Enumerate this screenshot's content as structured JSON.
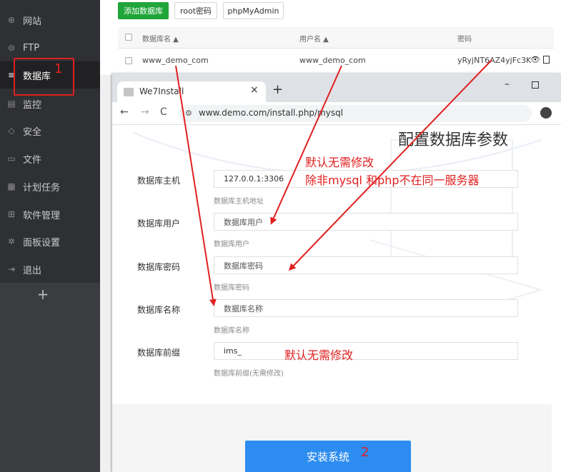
{
  "sidebar": {
    "items": [
      {
        "label": "网站",
        "icon": "globe-icon"
      },
      {
        "label": "FTP",
        "icon": "ftp-icon"
      },
      {
        "label": "数据库",
        "icon": "database-icon"
      },
      {
        "label": "监控",
        "icon": "monitor-icon"
      },
      {
        "label": "安全",
        "icon": "shield-icon"
      },
      {
        "label": "文件",
        "icon": "folder-icon"
      },
      {
        "label": "计划任务",
        "icon": "calendar-icon"
      },
      {
        "label": "软件管理",
        "icon": "grid-icon"
      },
      {
        "label": "面板设置",
        "icon": "gear-icon"
      },
      {
        "label": "退出",
        "icon": "logout-icon"
      }
    ],
    "active_index": 2,
    "add_label": "+"
  },
  "db_panel": {
    "buttons": {
      "add": "添加数据库",
      "root_pwd": "root密码",
      "phpmyadmin": "phpMyAdmin"
    },
    "columns": {
      "name": "数据库名 ▲",
      "user": "用户名 ▲",
      "password": "密码"
    },
    "row": {
      "name": "www_demo_com",
      "user": "www_demo_com",
      "password": "yRyjNT6AZ4yjFc3K"
    }
  },
  "browser": {
    "tab_title": "We7Install",
    "tab_close": "×",
    "new_tab": "+",
    "minimize": "–",
    "url": "www.demo.com/install.php/mysql"
  },
  "form": {
    "title": "配置数据库参数",
    "fields": [
      {
        "label": "数据库主机",
        "value": "127.0.0.1:3306",
        "help": "数据库主机地址"
      },
      {
        "label": "数据库用户",
        "value": "数据库用户",
        "help": "数据库用户"
      },
      {
        "label": "数据库密码",
        "value": "数据库密码",
        "help": "数据库密码"
      },
      {
        "label": "数据库名称",
        "value": "数据库名称",
        "help": "数据库名称"
      },
      {
        "label": "数据库前缀",
        "value": "ims_",
        "help": "数据库前缀(无需修改)"
      }
    ],
    "submit": "安装系统"
  },
  "annotations": {
    "step1": "1",
    "step2": "2",
    "note_default": "默认无需修改",
    "note_except": "除非mysql   和php不在同一服务器",
    "note_prefix": "默认无需修改",
    "color": "#e02020"
  }
}
